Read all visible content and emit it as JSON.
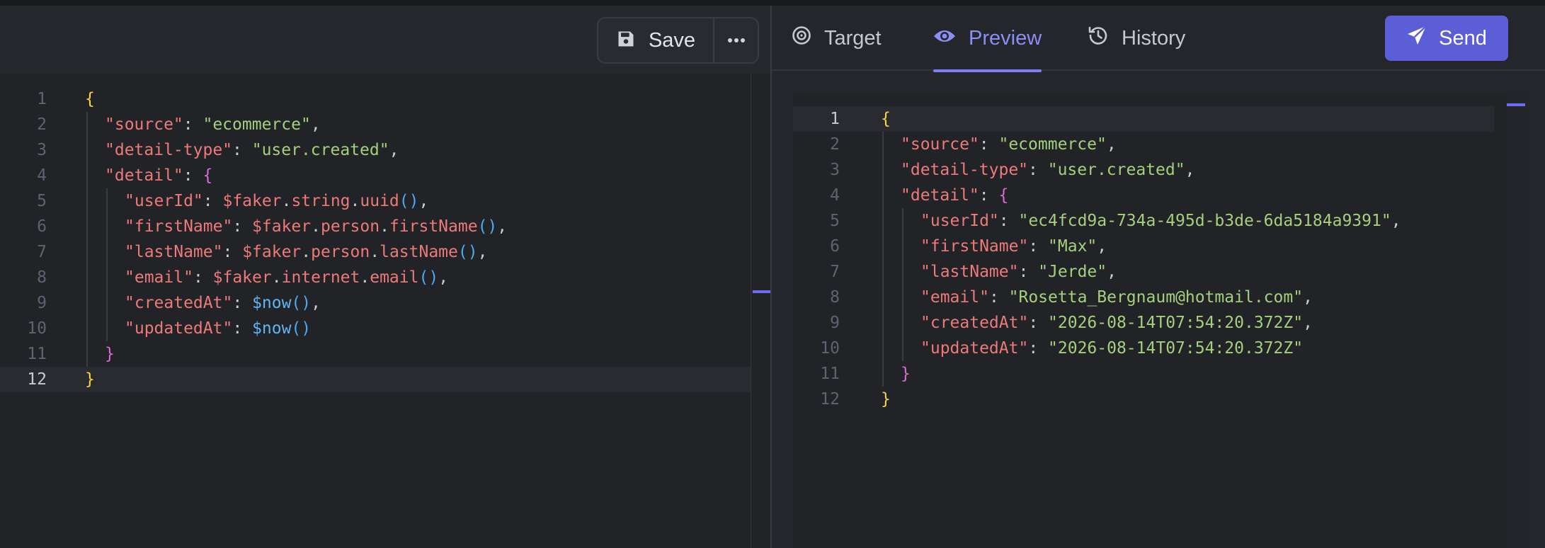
{
  "toolbar": {
    "save_label": "Save",
    "save_icon": "floppy-disk-icon",
    "more_icon": "ellipsis-icon"
  },
  "tabs": [
    {
      "label": "Target",
      "icon": "target-icon"
    },
    {
      "label": "Preview",
      "icon": "eye-icon",
      "active": true
    },
    {
      "label": "History",
      "icon": "history-icon"
    }
  ],
  "send": {
    "label": "Send",
    "icon": "paper-plane-icon"
  },
  "colors": {
    "accent": "#5b5ed6",
    "active_tab": "#8b8ef7",
    "key": "#ec7a7a",
    "string": "#a4d07e",
    "brace1": "#f5d547",
    "brace2": "#d86cd4",
    "call": "#4ea8f0"
  },
  "template_editor": {
    "active_line": 12,
    "lines": [
      {
        "n": "1",
        "tokens": [
          [
            "brace1",
            "{"
          ]
        ]
      },
      {
        "n": "2",
        "tokens": [
          [
            "key",
            "\"source\""
          ],
          [
            "punc",
            ": "
          ],
          [
            "str",
            "\"ecommerce\""
          ],
          [
            "punc",
            ","
          ]
        ]
      },
      {
        "n": "3",
        "tokens": [
          [
            "key",
            "\"detail-type\""
          ],
          [
            "punc",
            ": "
          ],
          [
            "str",
            "\"user.created\""
          ],
          [
            "punc",
            ","
          ]
        ]
      },
      {
        "n": "4",
        "tokens": [
          [
            "key",
            "\"detail\""
          ],
          [
            "punc",
            ": "
          ],
          [
            "brace2",
            "{"
          ]
        ]
      },
      {
        "n": "5",
        "tokens": [
          [
            "key",
            "\"userId\""
          ],
          [
            "punc",
            ": "
          ],
          [
            "fn",
            "$faker"
          ],
          [
            "punc",
            "."
          ],
          [
            "fn",
            "string"
          ],
          [
            "punc",
            "."
          ],
          [
            "fn",
            "uuid"
          ],
          [
            "par",
            "()"
          ],
          [
            "punc",
            ","
          ]
        ]
      },
      {
        "n": "6",
        "tokens": [
          [
            "key",
            "\"firstName\""
          ],
          [
            "punc",
            ": "
          ],
          [
            "fn",
            "$faker"
          ],
          [
            "punc",
            "."
          ],
          [
            "fn",
            "person"
          ],
          [
            "punc",
            "."
          ],
          [
            "fn",
            "firstName"
          ],
          [
            "par",
            "()"
          ],
          [
            "punc",
            ","
          ]
        ]
      },
      {
        "n": "7",
        "tokens": [
          [
            "key",
            "\"lastName\""
          ],
          [
            "punc",
            ": "
          ],
          [
            "fn",
            "$faker"
          ],
          [
            "punc",
            "."
          ],
          [
            "fn",
            "person"
          ],
          [
            "punc",
            "."
          ],
          [
            "fn",
            "lastName"
          ],
          [
            "par",
            "()"
          ],
          [
            "punc",
            ","
          ]
        ]
      },
      {
        "n": "8",
        "tokens": [
          [
            "key",
            "\"email\""
          ],
          [
            "punc",
            ": "
          ],
          [
            "fn",
            "$faker"
          ],
          [
            "punc",
            "."
          ],
          [
            "fn",
            "internet"
          ],
          [
            "punc",
            "."
          ],
          [
            "fn",
            "email"
          ],
          [
            "par",
            "()"
          ],
          [
            "punc",
            ","
          ]
        ]
      },
      {
        "n": "9",
        "tokens": [
          [
            "key",
            "\"createdAt\""
          ],
          [
            "punc",
            ": "
          ],
          [
            "var",
            "$now"
          ],
          [
            "par",
            "()"
          ],
          [
            "punc",
            ","
          ]
        ]
      },
      {
        "n": "10",
        "tokens": [
          [
            "key",
            "\"updatedAt\""
          ],
          [
            "punc",
            ": "
          ],
          [
            "var",
            "$now"
          ],
          [
            "par",
            "()"
          ]
        ]
      },
      {
        "n": "11",
        "tokens": [
          [
            "brace2",
            "}"
          ]
        ]
      },
      {
        "n": "12",
        "tokens": [
          [
            "brace1",
            "}"
          ]
        ]
      }
    ]
  },
  "preview_editor": {
    "active_line": 1,
    "lines": [
      {
        "n": "1",
        "tokens": [
          [
            "brace1",
            "{"
          ]
        ]
      },
      {
        "n": "2",
        "tokens": [
          [
            "key",
            "\"source\""
          ],
          [
            "punc",
            ": "
          ],
          [
            "str",
            "\"ecommerce\""
          ],
          [
            "punc",
            ","
          ]
        ]
      },
      {
        "n": "3",
        "tokens": [
          [
            "key",
            "\"detail-type\""
          ],
          [
            "punc",
            ": "
          ],
          [
            "str",
            "\"user.created\""
          ],
          [
            "punc",
            ","
          ]
        ]
      },
      {
        "n": "4",
        "tokens": [
          [
            "key",
            "\"detail\""
          ],
          [
            "punc",
            ": "
          ],
          [
            "brace2",
            "{"
          ]
        ]
      },
      {
        "n": "5",
        "tokens": [
          [
            "key",
            "\"userId\""
          ],
          [
            "punc",
            ": "
          ],
          [
            "str",
            "\"ec4fcd9a-734a-495d-b3de-6da5184a9391\""
          ],
          [
            "punc",
            ","
          ]
        ]
      },
      {
        "n": "6",
        "tokens": [
          [
            "key",
            "\"firstName\""
          ],
          [
            "punc",
            ": "
          ],
          [
            "str",
            "\"Max\""
          ],
          [
            "punc",
            ","
          ]
        ]
      },
      {
        "n": "7",
        "tokens": [
          [
            "key",
            "\"lastName\""
          ],
          [
            "punc",
            ": "
          ],
          [
            "str",
            "\"Jerde\""
          ],
          [
            "punc",
            ","
          ]
        ]
      },
      {
        "n": "8",
        "tokens": [
          [
            "key",
            "\"email\""
          ],
          [
            "punc",
            ": "
          ],
          [
            "str",
            "\"Rosetta_Bergnaum@hotmail.com\""
          ],
          [
            "punc",
            ","
          ]
        ]
      },
      {
        "n": "9",
        "tokens": [
          [
            "key",
            "\"createdAt\""
          ],
          [
            "punc",
            ": "
          ],
          [
            "str",
            "\"2026-08-14T07:54:20.372Z\""
          ],
          [
            "punc",
            ","
          ]
        ]
      },
      {
        "n": "10",
        "tokens": [
          [
            "key",
            "\"updatedAt\""
          ],
          [
            "punc",
            ": "
          ],
          [
            "str",
            "\"2026-08-14T07:54:20.372Z\""
          ]
        ]
      },
      {
        "n": "11",
        "tokens": [
          [
            "brace2",
            "}"
          ]
        ]
      },
      {
        "n": "12",
        "tokens": [
          [
            "brace1",
            "}"
          ]
        ]
      }
    ]
  }
}
